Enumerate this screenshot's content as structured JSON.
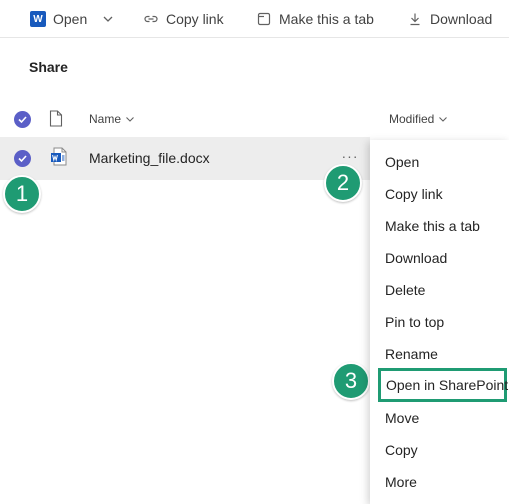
{
  "toolbar": {
    "open_label": "Open",
    "open_icon": "word-icon",
    "word_letter": "W",
    "copy_link_label": "Copy link",
    "make_tab_label": "Make this a tab",
    "download_label": "Download"
  },
  "heading": "Share",
  "columns": {
    "name_label": "Name",
    "modified_label": "Modified"
  },
  "file": {
    "name": "Marketing_file.docx",
    "icon": "word-document-icon",
    "selected": true,
    "more_label": "···"
  },
  "steps": [
    "1",
    "2",
    "3"
  ],
  "context_menu": {
    "items": [
      "Open",
      "Copy link",
      "Make this a tab",
      "Download",
      "Delete",
      "Pin to top",
      "Rename",
      "Open in SharePoint",
      "Move",
      "Copy",
      "More"
    ],
    "highlighted_index": 7
  },
  "colors": {
    "accent": "#5b5fc7",
    "step_marker": "#1f9b73",
    "word_blue": "#185abd",
    "row_selected": "#ededed"
  }
}
